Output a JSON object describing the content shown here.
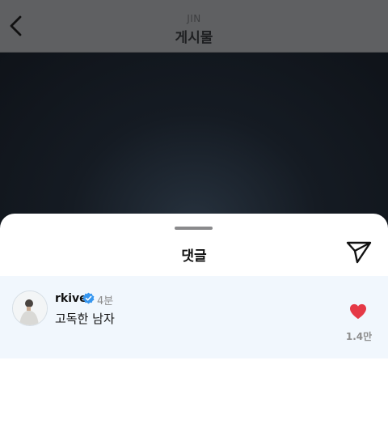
{
  "header": {
    "subtitle": "JIN",
    "title": "게시물"
  },
  "sheet": {
    "title": "댓글"
  },
  "comments": [
    {
      "username": "rkive",
      "verified": true,
      "time": "4분",
      "text": "고독한 남자",
      "likes": "1.4만",
      "liked": true
    }
  ],
  "colors": {
    "header_bg": "#5f6062",
    "comment_bg": "#f1f7fd",
    "heart": "#e53946",
    "verified": "#3797f0"
  },
  "icons": [
    "back-chevron-icon",
    "send-icon",
    "verified-badge-icon",
    "heart-icon"
  ]
}
